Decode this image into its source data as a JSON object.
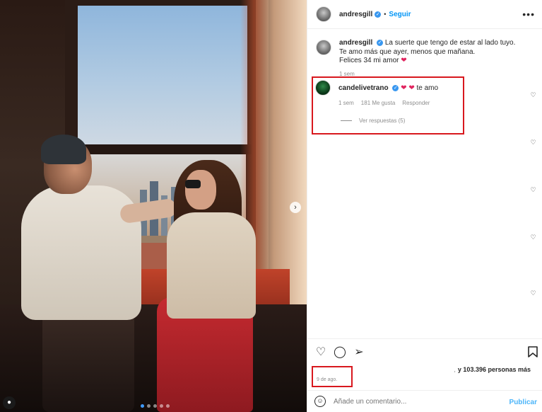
{
  "post": {
    "author": "andresgill",
    "follow_label": "Seguir",
    "dot_sep": "•",
    "more_icon": "more-horizontal-icon",
    "caption": {
      "line1": "La suerte que tengo de estar al lado tuyo.",
      "line2": "Te amo más que ayer, menos que mañana.",
      "line3": "Felices 34 mi amor",
      "emoji": "❤",
      "time": "1 sem"
    },
    "comment": {
      "author": "candelivetrano",
      "emoji": "❤ ❤",
      "text": "te amo",
      "time": "1 sem",
      "likes": "181 Me gusta",
      "reply_label": "Responder",
      "view_replies": "Ver respuestas (5)"
    },
    "likes_comma": ",",
    "likes_text": "y 103.396 personas más",
    "date": "9 de ago.",
    "comment_placeholder": "Añade un comentario...",
    "publish_label": "Publicar"
  },
  "carousel": {
    "total": 5,
    "active": 1
  },
  "icons": {
    "like": "heart-outline-icon",
    "comment": "comment-bubble-icon",
    "share": "paper-plane-icon",
    "save": "bookmark-icon",
    "emoji": "smiley-icon",
    "next": "chevron-right-icon",
    "tag": "user-tag-icon",
    "verified": "verified-badge-icon"
  },
  "colors": {
    "accent": "#0095f6",
    "highlight": "#d8181e",
    "verified": "#3897f0"
  }
}
